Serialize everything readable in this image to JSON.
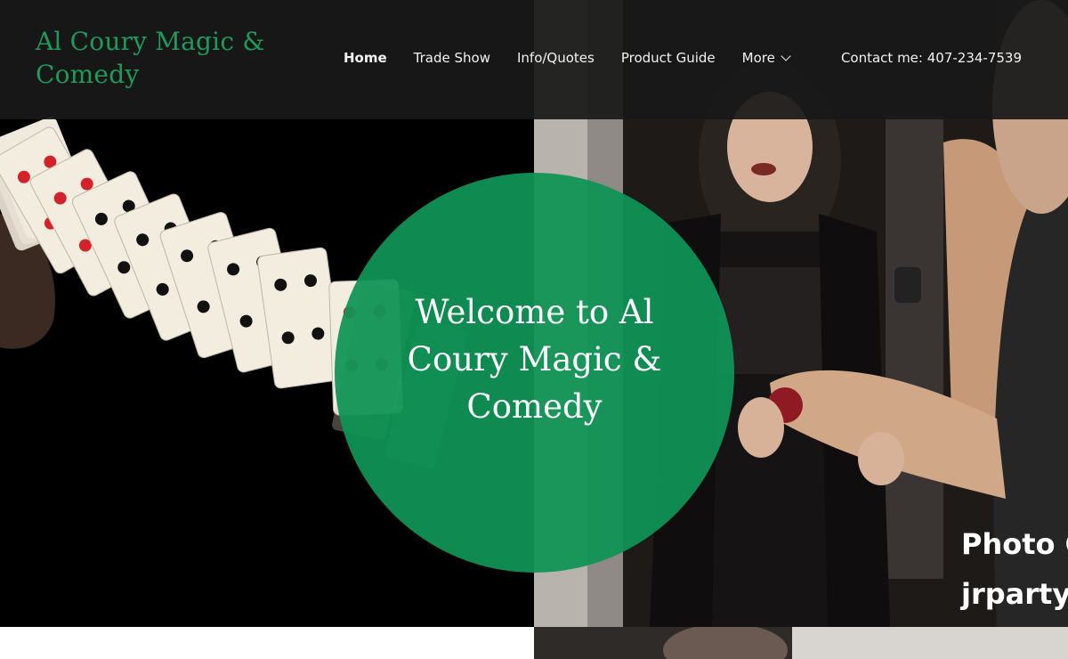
{
  "site": {
    "logo": "Al Coury Magic & Comedy"
  },
  "nav": {
    "items": [
      {
        "label": "Home",
        "active": true
      },
      {
        "label": "Trade Show"
      },
      {
        "label": "Info/Quotes"
      },
      {
        "label": "Product Guide"
      },
      {
        "label": "More",
        "has_dropdown": true
      }
    ]
  },
  "contact": "Contact me: 407-234-7539",
  "hero": {
    "headline": "Welcome to Al Coury Magic & Comedy",
    "photo_credit_line1": "Photo C",
    "photo_credit_line2": "jrpartys"
  },
  "colors": {
    "brand_green": "#1e9a5a",
    "circle_green": "#109456",
    "header_bg": "#191919"
  }
}
